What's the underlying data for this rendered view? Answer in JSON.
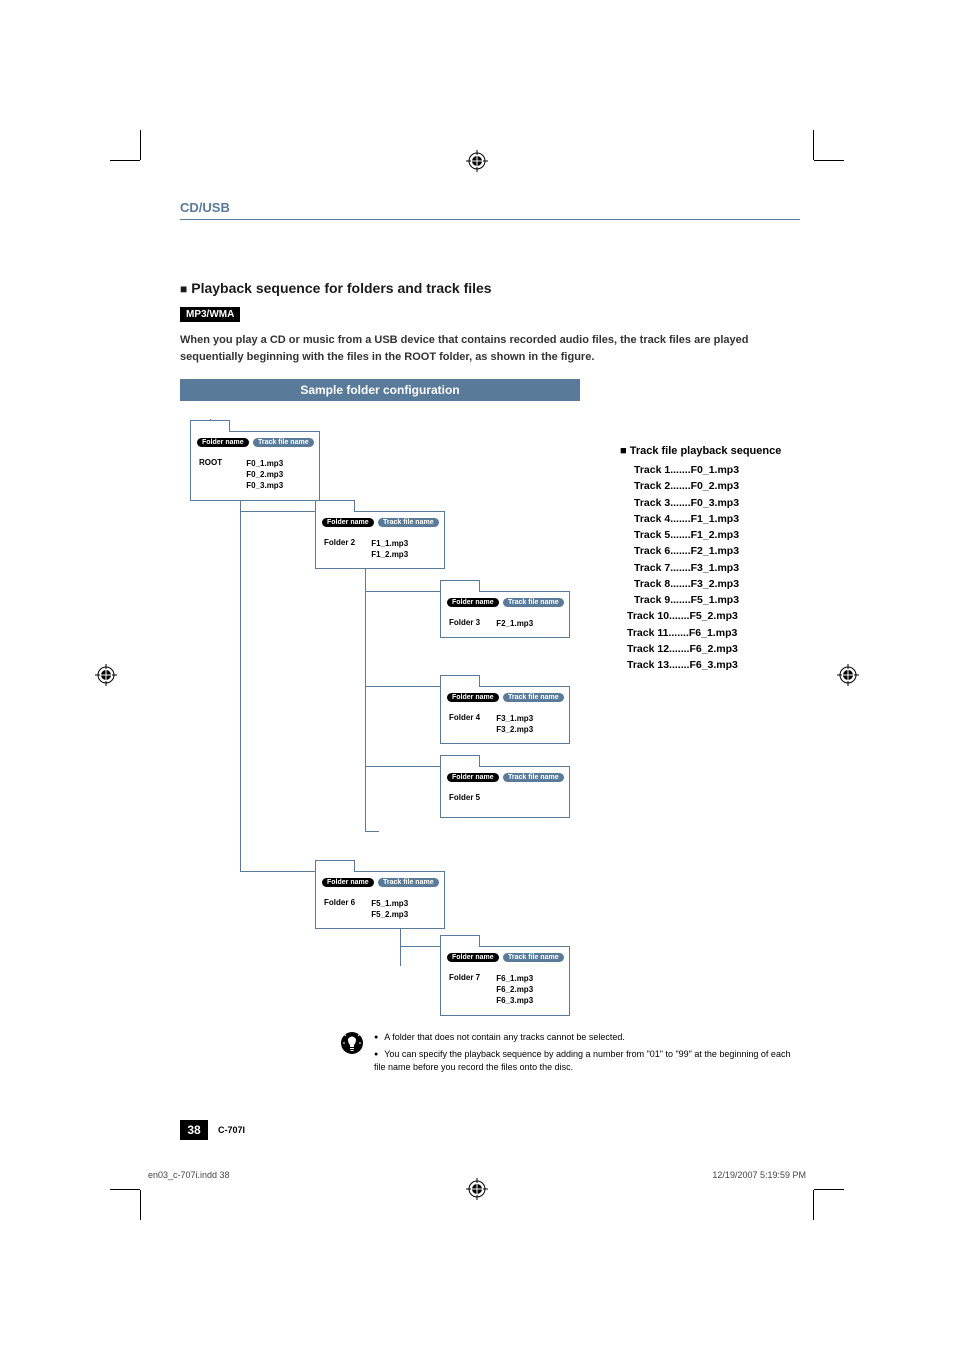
{
  "header": {
    "section": "CD/USB"
  },
  "subtitle": "Playback sequence for folders and track files",
  "format_badge": "MP3/WMA",
  "intro": "When you play a CD or music from a USB device that contains recorded audio files, the track files are played sequentially beginning with the files in the ROOT folder, as shown in the figure.",
  "sample_header": "Sample folder configuration",
  "labels": {
    "folder_name": "Folder name",
    "track_file_name": "Track file name"
  },
  "folders": {
    "root": {
      "name": "ROOT",
      "tracks": [
        "F0_1.mp3",
        "F0_2.mp3",
        "F0_3.mp3"
      ]
    },
    "f2": {
      "name": "Folder 2",
      "tracks": [
        "F1_1.mp3",
        "F1_2.mp3"
      ]
    },
    "f3": {
      "name": "Folder 3",
      "tracks": [
        "F2_1.mp3"
      ]
    },
    "f4": {
      "name": "Folder 4",
      "tracks": [
        "F3_1.mp3",
        "F3_2.mp3"
      ]
    },
    "f5": {
      "name": "Folder 5",
      "tracks": []
    },
    "f6": {
      "name": "Folder 6",
      "tracks": [
        "F5_1.mp3",
        "F5_2.mp3"
      ]
    },
    "f7": {
      "name": "Folder 7",
      "tracks": [
        "F6_1.mp3",
        "F6_2.mp3",
        "F6_3.mp3"
      ]
    }
  },
  "sequence": {
    "title": "■ Track file playback sequence",
    "rows": [
      "Track 1.......F0_1.mp3",
      "Track 2.......F0_2.mp3",
      "Track 3.......F0_3.mp3",
      "Track 4.......F1_1.mp3",
      "Track 5.......F1_2.mp3",
      "Track 6.......F2_1.mp3",
      "Track 7.......F3_1.mp3",
      "Track 8.......F3_2.mp3",
      "Track 9.......F5_1.mp3",
      "Track 10.......F5_2.mp3",
      "Track 11.......F6_1.mp3",
      "Track 12.......F6_2.mp3",
      "Track 13.......F6_3.mp3"
    ]
  },
  "notes": [
    "A folder that does not contain any tracks cannot be selected.",
    "You can specify the playback sequence by adding a number from \"01\" to \"99\" at the beginning of each file name before you record the files onto the disc."
  ],
  "footer": {
    "page": "38",
    "model": "C-707I"
  },
  "print_footer": {
    "left": "en03_c-707i.indd   38",
    "right": "12/19/2007   5:19:59 PM"
  }
}
